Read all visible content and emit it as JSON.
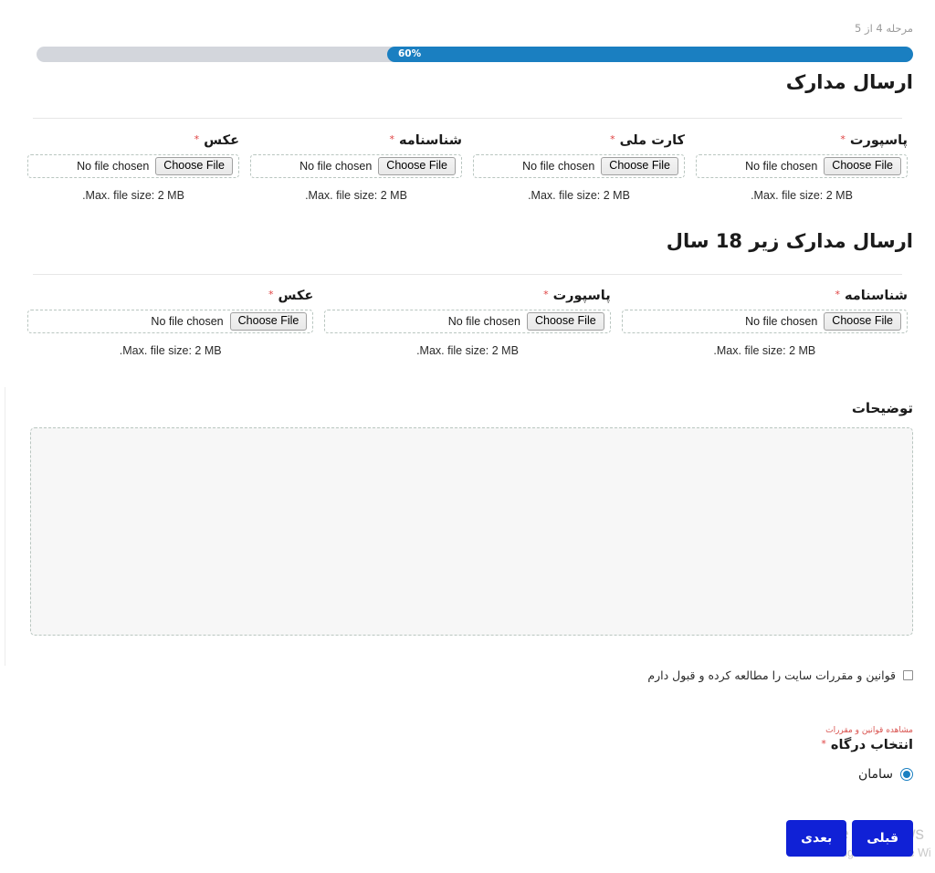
{
  "wizard": {
    "step_text": "مرحله 4 از 5",
    "progress_percent_label": "60%",
    "progress_value": 60,
    "progress_fill_color": "#1a7fc1",
    "progress_track_color": "#d3d6dc"
  },
  "sections": [
    {
      "title": "ارسال مدارک",
      "fields": [
        {
          "label": "پاسپورت",
          "required": true,
          "no_file_text": "No file chosen",
          "choose_label": "Choose File",
          "hint": ".Max. file size: 2 MB"
        },
        {
          "label": "کارت ملی",
          "required": true,
          "no_file_text": "No file chosen",
          "choose_label": "Choose File",
          "hint": ".Max. file size: 2 MB"
        },
        {
          "label": "شناسنامه",
          "required": true,
          "no_file_text": "No file chosen",
          "choose_label": "Choose File",
          "hint": ".Max. file size: 2 MB"
        },
        {
          "label": "عکس",
          "required": true,
          "no_file_text": "No file chosen",
          "choose_label": "Choose File",
          "hint": ".Max. file size: 2 MB"
        }
      ]
    },
    {
      "title": "ارسال مدارک زیر 18 سال",
      "fields": [
        {
          "label": "شناسنامه",
          "required": true,
          "no_file_text": "No file chosen",
          "choose_label": "Choose File",
          "hint": ".Max. file size: 2 MB"
        },
        {
          "label": "پاسپورت",
          "required": true,
          "no_file_text": "No file chosen",
          "choose_label": "Choose File",
          "hint": ".Max. file size: 2 MB"
        },
        {
          "label": "عکس",
          "required": true,
          "no_file_text": "No file chosen",
          "choose_label": "Choose File",
          "hint": ".Max. file size: 2 MB"
        }
      ]
    }
  ],
  "comments": {
    "label": "توضیحات",
    "value": "",
    "placeholder": ""
  },
  "terms": {
    "checkbox_label": "قوانین و مقررات سایت را مطالعه کرده و قبول دارم",
    "checked": false,
    "link_text": "مشاهده قوانین و مقررات",
    "link_color": "#d9534f"
  },
  "gateway": {
    "label": "انتخاب درگاه",
    "required": true,
    "options": [
      {
        "name": "سامان",
        "selected": true
      }
    ],
    "accent_color": "#1a7fc1"
  },
  "buttons": {
    "prev_label": "قبلی",
    "next_label": "بعدی",
    "color": "#1021d6"
  },
  "watermark": {
    "line1": "Activate Windows",
    "line2": "Go to Settings to activate Wi"
  },
  "required_marker": "*"
}
